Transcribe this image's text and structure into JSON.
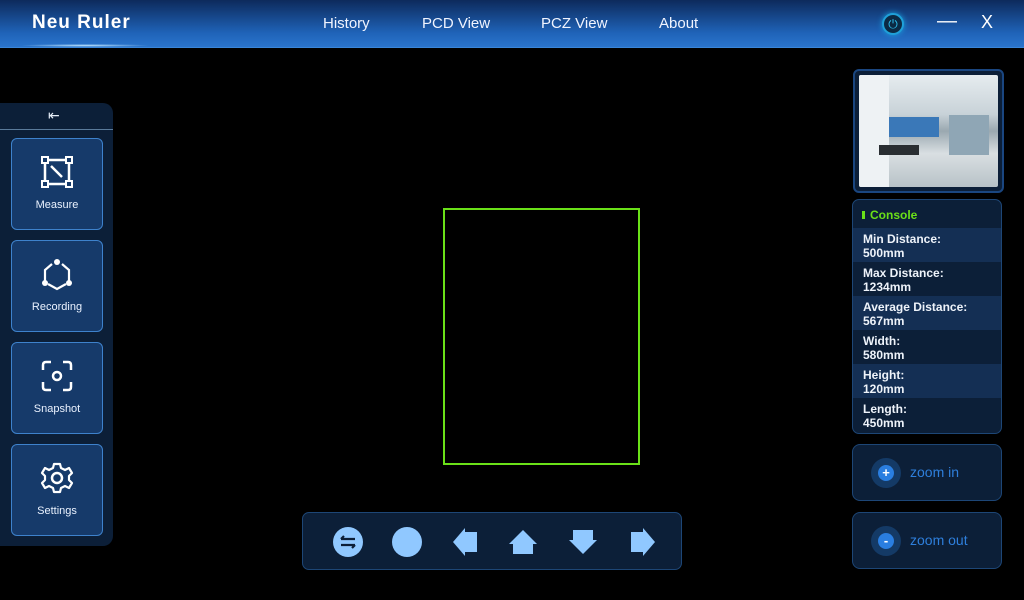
{
  "header": {
    "title": "Neu Ruler",
    "nav": [
      "History",
      "PCD View",
      "PCZ View",
      "About"
    ],
    "power_icon": "power-icon",
    "minimize": "—",
    "close": "X"
  },
  "sidebar": {
    "collapse_icon": "menu-collapse-icon",
    "items": [
      {
        "label": "Measure",
        "icon": "measure-icon"
      },
      {
        "label": "Recording",
        "icon": "recording-icon"
      },
      {
        "label": "Snapshot",
        "icon": "snapshot-icon"
      },
      {
        "label": "Settings",
        "icon": "gear-icon"
      }
    ]
  },
  "console": {
    "title": "Console",
    "rows": [
      {
        "label": "Min Distance:",
        "value": "500mm"
      },
      {
        "label": "Max Distance:",
        "value": "1234mm"
      },
      {
        "label": "Average Distance:",
        "value": "567mm"
      },
      {
        "label": "Width:",
        "value": "580mm"
      },
      {
        "label": "Height:",
        "value": "120mm"
      },
      {
        "label": "Length:",
        "value": "450mm"
      }
    ]
  },
  "zoom": {
    "in_label": "zoom in",
    "out_label": "zoom out",
    "in_symbol": "+",
    "out_symbol": "-"
  },
  "controls": [
    "swap-icon",
    "record-circle-icon",
    "arrow-left-icon",
    "arrow-up-icon",
    "arrow-down-icon",
    "arrow-right-icon"
  ],
  "colors": {
    "accent": "#2e7fdc",
    "bbox": "#6ae018",
    "icon": "#90c8ff"
  }
}
